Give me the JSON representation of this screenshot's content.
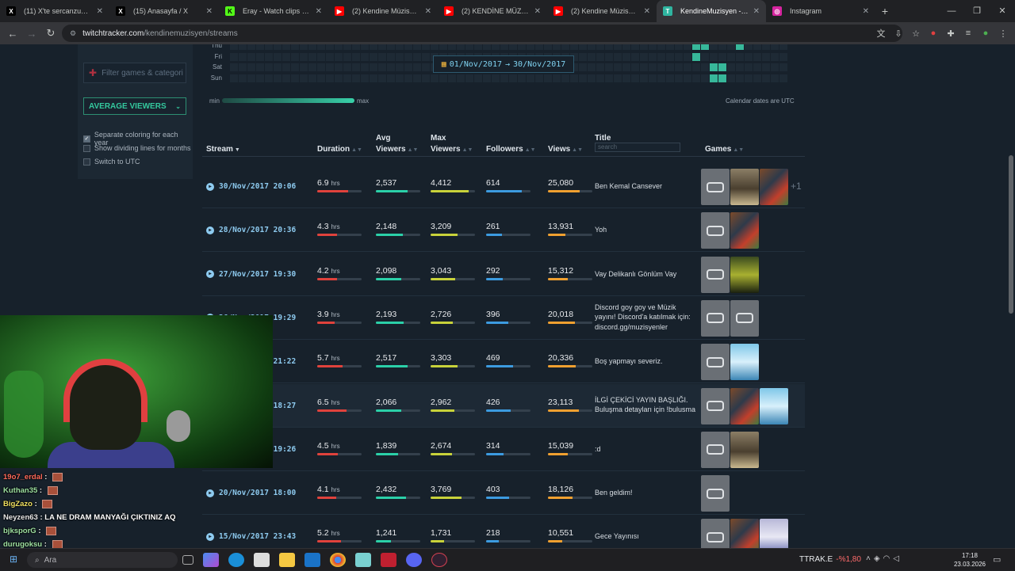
{
  "browser": {
    "tabs": [
      {
        "title": "(11) X'te sercanzuma: \"BE",
        "fav": "X",
        "fav_color": "#000000",
        "fav_text": "#ffffff"
      },
      {
        "title": "(15) Anasayfa / X",
        "fav": "X",
        "fav_color": "#000000",
        "fav_text": "#ffffff"
      },
      {
        "title": "Eray - Watch clips on Kick",
        "fav": "K",
        "fav_color": "#53fc18",
        "fav_text": "#000000"
      },
      {
        "title": "(2) Kendine Müzisyen Bir",
        "fav": "▶",
        "fav_color": "#ff0000",
        "fav_text": "#ffffff"
      },
      {
        "title": "(2) KENDİNE MÜZİSYEN B",
        "fav": "▶",
        "fav_color": "#ff0000",
        "fav_text": "#ffffff"
      },
      {
        "title": "(2) Kendine Müzisyen | Ta",
        "fav": "▶",
        "fav_color": "#ff0000",
        "fav_text": "#ffffff"
      },
      {
        "title": "KendineMuzisyen - Stream",
        "fav": "T",
        "fav_color": "#2fb5a0",
        "fav_text": "#ffffff"
      },
      {
        "title": "Instagram",
        "fav": "◎",
        "fav_color": "#d6249f",
        "fav_text": "#ffffff"
      }
    ],
    "url_host": "twitchtracker.com",
    "url_path": "/kendinemuzisyen/streams"
  },
  "sidebar": {
    "filter_placeholder": "Filter games & categori",
    "metric_select": "AVERAGE VIEWERS",
    "options": [
      {
        "label": "Separate coloring for each year",
        "checked": true
      },
      {
        "label": "Show dividing lines for months",
        "checked": false
      },
      {
        "label": "Switch to UTC",
        "checked": false
      }
    ]
  },
  "calendar": {
    "days": [
      "Thu",
      "Fri",
      "Sat",
      "Sun"
    ],
    "date_from": "01/Nov/2017",
    "arrow": "→",
    "date_to": "30/Nov/2017",
    "legend_min": "min",
    "legend_max": "max",
    "note": "Calendar dates are UTC"
  },
  "table": {
    "headers": {
      "stream": "Stream",
      "duration": "Duration",
      "avg_viewers": "Avg Viewers",
      "max_viewers": "Max Viewers",
      "followers": "Followers",
      "views": "Views",
      "title": "Title",
      "title_search": "search",
      "games": "Games"
    },
    "duration_unit": "hrs",
    "rows": [
      {
        "date": "30/Nov/2017 20:06",
        "duration": "6.9",
        "avg": "2,537",
        "max": "4,412",
        "followers": "614",
        "views": "25,080",
        "title": "Ben Kemal Cansever",
        "games": [
          "ph",
          "pubg",
          "gta"
        ],
        "more": "+1",
        "bars": [
          0.69,
          0.72,
          0.85,
          0.8,
          0.72
        ]
      },
      {
        "date": "28/Nov/2017 20:36",
        "duration": "4.3",
        "avg": "2,148",
        "max": "3,209",
        "followers": "261",
        "views": "13,931",
        "title": "Yoh",
        "games": [
          "ph",
          "gta"
        ],
        "more": "",
        "bars": [
          0.45,
          0.6,
          0.6,
          0.35,
          0.4
        ]
      },
      {
        "date": "27/Nov/2017 19:30",
        "duration": "4.2",
        "avg": "2,098",
        "max": "3,043",
        "followers": "292",
        "views": "15,312",
        "title": "Vay Delikanlı Gönlüm Vay",
        "games": [
          "ph",
          "z2"
        ],
        "more": "",
        "bars": [
          0.44,
          0.58,
          0.55,
          0.38,
          0.45
        ]
      },
      {
        "date": "26/Nov/2017 19:29",
        "duration": "3.9",
        "avg": "2,193",
        "max": "2,726",
        "followers": "396",
        "views": "20,018",
        "title": "Discord goy goy ve Müzik yayını! Discord'a katılmak için: discord.gg/muzisyenler",
        "games": [
          "ph",
          "ph"
        ],
        "more": "",
        "bars": [
          0.4,
          0.62,
          0.5,
          0.5,
          0.6
        ]
      },
      {
        "date": "24/Nov/2017 21:22",
        "duration": "5.7",
        "avg": "2,517",
        "max": "3,303",
        "followers": "469",
        "views": "20,336",
        "title": "Boş yapmayı severiz.",
        "games": [
          "ph",
          "ssx"
        ],
        "more": "",
        "bars": [
          0.58,
          0.72,
          0.6,
          0.6,
          0.62
        ]
      },
      {
        "date": "22/Nov/2017 18:27",
        "duration": "6.5",
        "avg": "2,066",
        "max": "2,962",
        "followers": "426",
        "views": "23,113",
        "title": "İLGİ ÇEKİCİ YAYIN BAŞLIĞI. Buluşma detayları için !bulusma",
        "games": [
          "ph",
          "gta",
          "ssx"
        ],
        "more": "",
        "bars": [
          0.66,
          0.57,
          0.53,
          0.55,
          0.7
        ]
      },
      {
        "date": "21/Nov/2017 19:26",
        "duration": "4.5",
        "avg": "1,839",
        "max": "2,674",
        "followers": "314",
        "views": "15,039",
        "title": ":d",
        "games": [
          "ph",
          "pubg"
        ],
        "more": "",
        "bars": [
          0.46,
          0.5,
          0.48,
          0.4,
          0.45
        ]
      },
      {
        "date": "20/Nov/2017 18:00",
        "duration": "4.1",
        "avg": "2,432",
        "max": "3,769",
        "followers": "403",
        "views": "18,126",
        "title": "Ben geldim!",
        "games": [
          "ph"
        ],
        "more": "",
        "bars": [
          0.42,
          0.68,
          0.7,
          0.52,
          0.55
        ]
      },
      {
        "date": "15/Nov/2017 23:43",
        "duration": "5.2",
        "avg": "1,241",
        "max": "1,731",
        "followers": "218",
        "views": "10,551",
        "title": "Gece Yayınısı",
        "games": [
          "ph",
          "gta",
          "tu"
        ],
        "more": "",
        "bars": [
          0.53,
          0.34,
          0.3,
          0.28,
          0.32
        ]
      }
    ],
    "bar_colors": [
      "#e0423c",
      "#2bd0a8",
      "#c8d23a",
      "#3c9be0",
      "#f0a030"
    ]
  },
  "stream_chat": [
    {
      "user": "19o7_erdal",
      "msg": "",
      "color": "#ff6a5a",
      "emote": true
    },
    {
      "user": "Kuthan35",
      "msg": "",
      "color": "#9de0a0",
      "emote": true
    },
    {
      "user": "BigZazo",
      "msg": "",
      "color": "#f0e060",
      "emote": true
    },
    {
      "user": "Neyzen63",
      "msg": "LA NE DRAM MANYAĞI ÇIKTINIZ AQ",
      "color": "#e8e8e8",
      "emote": false
    },
    {
      "user": "bjksporG",
      "msg": "",
      "color": "#9de0a0",
      "emote": true
    },
    {
      "user": "durugoksu",
      "msg": "",
      "color": "#9de0a0",
      "emote": true
    }
  ],
  "taskbar": {
    "search": "Ara",
    "ticker_symbol": "TTRAK.E",
    "ticker_change": "-%1,80",
    "time": "17:18",
    "date": "23.03.2026"
  }
}
